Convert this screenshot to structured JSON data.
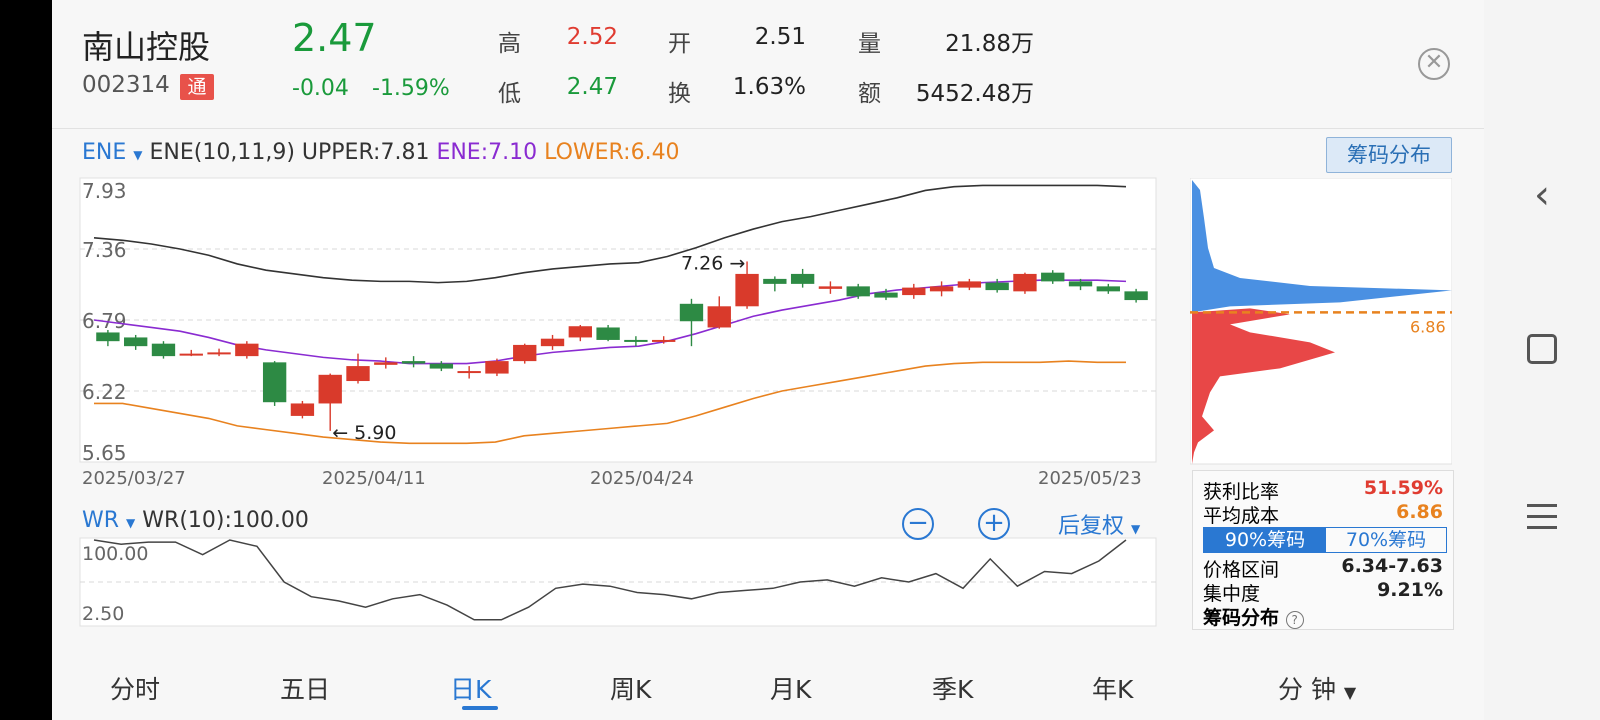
{
  "stock": {
    "name": "南山控股",
    "code": "002314",
    "tong_badge": "通",
    "price": "2.47",
    "change": "-0.04",
    "change_pct": "-1.59%"
  },
  "quote": {
    "high_label": "高",
    "high_value": "2.52",
    "low_label": "低",
    "low_value": "2.47",
    "open_label": "开",
    "open_value": "2.51",
    "turnover_label": "换",
    "turnover_value": "1.63%",
    "volume_label": "量",
    "volume_value": "21.88万",
    "amount_label": "额",
    "amount_value": "5452.48万"
  },
  "close_icon": "close-icon",
  "ene": {
    "indicator": "ENE",
    "params": "ENE(10,11,9)",
    "upper": "UPPER:7.81",
    "ene": "ENE:7.10",
    "lower": "LOWER:6.40",
    "colors": {
      "upper": "#333333",
      "ene": "#8a2bd1",
      "lower": "#e8821f"
    }
  },
  "chip_button": "筹码分布",
  "chart_data": {
    "type": "candlestick",
    "y_ticks": [
      "7.93",
      "7.36",
      "6.79",
      "6.22",
      "5.65"
    ],
    "y_tick_values": [
      7.93,
      7.36,
      6.79,
      6.22,
      5.65
    ],
    "ylim": [
      5.65,
      7.93
    ],
    "x_labels": [
      "2025/03/27",
      "2025/04/11",
      "2025/04/24",
      "2025/05/23"
    ],
    "annotations": {
      "high": "7.26",
      "low": "5.90"
    },
    "candles": [
      {
        "o": 6.69,
        "c": 6.62,
        "h": 6.71,
        "l": 6.58
      },
      {
        "o": 6.65,
        "c": 6.58,
        "h": 6.67,
        "l": 6.55
      },
      {
        "o": 6.6,
        "c": 6.5,
        "h": 6.62,
        "l": 6.48
      },
      {
        "o": 6.51,
        "c": 6.52,
        "h": 6.55,
        "l": 6.5
      },
      {
        "o": 6.52,
        "c": 6.53,
        "h": 6.56,
        "l": 6.5
      },
      {
        "o": 6.5,
        "c": 6.6,
        "h": 6.62,
        "l": 6.48
      },
      {
        "o": 6.45,
        "c": 6.13,
        "h": 6.46,
        "l": 6.1
      },
      {
        "o": 6.02,
        "c": 6.12,
        "h": 6.14,
        "l": 6.0
      },
      {
        "o": 6.12,
        "c": 6.35,
        "h": 6.36,
        "l": 5.9
      },
      {
        "o": 6.3,
        "c": 6.42,
        "h": 6.52,
        "l": 6.28
      },
      {
        "o": 6.43,
        "c": 6.45,
        "h": 6.49,
        "l": 6.4
      },
      {
        "o": 6.46,
        "c": 6.44,
        "h": 6.5,
        "l": 6.41
      },
      {
        "o": 6.44,
        "c": 6.4,
        "h": 6.46,
        "l": 6.38
      },
      {
        "o": 6.38,
        "c": 6.38,
        "h": 6.42,
        "l": 6.32
      },
      {
        "o": 6.36,
        "c": 6.46,
        "h": 6.48,
        "l": 6.34
      },
      {
        "o": 6.46,
        "c": 6.59,
        "h": 6.6,
        "l": 6.44
      },
      {
        "o": 6.58,
        "c": 6.64,
        "h": 6.67,
        "l": 6.55
      },
      {
        "o": 6.65,
        "c": 6.74,
        "h": 6.75,
        "l": 6.62
      },
      {
        "o": 6.73,
        "c": 6.63,
        "h": 6.75,
        "l": 6.62
      },
      {
        "o": 6.63,
        "c": 6.62,
        "h": 6.66,
        "l": 6.58
      },
      {
        "o": 6.62,
        "c": 6.63,
        "h": 6.66,
        "l": 6.6
      },
      {
        "o": 6.92,
        "c": 6.78,
        "h": 6.96,
        "l": 6.58
      },
      {
        "o": 6.73,
        "c": 6.9,
        "h": 6.98,
        "l": 6.72
      },
      {
        "o": 6.9,
        "c": 7.16,
        "h": 7.26,
        "l": 6.88
      },
      {
        "o": 7.12,
        "c": 7.08,
        "h": 7.14,
        "l": 7.02
      },
      {
        "o": 7.16,
        "c": 7.08,
        "h": 7.2,
        "l": 7.05
      },
      {
        "o": 7.04,
        "c": 7.06,
        "h": 7.1,
        "l": 7.0
      },
      {
        "o": 7.06,
        "c": 6.98,
        "h": 7.08,
        "l": 6.96
      },
      {
        "o": 7.01,
        "c": 6.97,
        "h": 7.04,
        "l": 6.95
      },
      {
        "o": 6.99,
        "c": 7.05,
        "h": 7.08,
        "l": 6.96
      },
      {
        "o": 7.02,
        "c": 7.06,
        "h": 7.1,
        "l": 6.98
      },
      {
        "o": 7.05,
        "c": 7.1,
        "h": 7.12,
        "l": 7.03
      },
      {
        "o": 7.09,
        "c": 7.03,
        "h": 7.12,
        "l": 7.01
      },
      {
        "o": 7.02,
        "c": 7.16,
        "h": 7.17,
        "l": 7.0
      },
      {
        "o": 7.17,
        "c": 7.1,
        "h": 7.19,
        "l": 7.08
      },
      {
        "o": 7.1,
        "c": 7.06,
        "h": 7.12,
        "l": 7.03
      },
      {
        "o": 7.06,
        "c": 7.02,
        "h": 7.08,
        "l": 7.0
      },
      {
        "o": 7.02,
        "c": 6.95,
        "h": 7.04,
        "l": 6.93
      }
    ],
    "upper": [
      7.45,
      7.43,
      7.4,
      7.36,
      7.31,
      7.24,
      7.19,
      7.16,
      7.13,
      7.11,
      7.1,
      7.1,
      7.09,
      7.1,
      7.13,
      7.17,
      7.2,
      7.22,
      7.24,
      7.25,
      7.3,
      7.37,
      7.45,
      7.52,
      7.58,
      7.62,
      7.67,
      7.72,
      7.77,
      7.83,
      7.86,
      7.87,
      7.87,
      7.87,
      7.87,
      7.87,
      7.86
    ],
    "ene_line": [
      6.79,
      6.76,
      6.73,
      6.7,
      6.65,
      6.59,
      6.55,
      6.52,
      6.49,
      6.47,
      6.46,
      6.44,
      6.44,
      6.44,
      6.46,
      6.5,
      6.53,
      6.55,
      6.57,
      6.58,
      6.62,
      6.68,
      6.75,
      6.82,
      6.87,
      6.91,
      6.95,
      7.0,
      7.03,
      7.05,
      7.07,
      7.09,
      7.1,
      7.11,
      7.11,
      7.11,
      7.1
    ],
    "lower": [
      6.12,
      6.12,
      6.08,
      6.04,
      6.0,
      5.94,
      5.91,
      5.88,
      5.85,
      5.83,
      5.81,
      5.8,
      5.8,
      5.8,
      5.81,
      5.86,
      5.88,
      5.9,
      5.92,
      5.94,
      5.96,
      6.02,
      6.09,
      6.16,
      6.22,
      6.26,
      6.3,
      6.34,
      6.38,
      6.42,
      6.44,
      6.45,
      6.45,
      6.45,
      6.46,
      6.45,
      6.45
    ]
  },
  "chip_dist": {
    "avg_cost_label": "6.86",
    "avg_cost_value": 6.86,
    "colors": {
      "profit": "#4a90e2",
      "loss": "#e84747",
      "avg": "#e8821f"
    },
    "profit_ratio_label": "获利比率",
    "profit_ratio_value": "51.59%",
    "avg_cost_row_label": "平均成本",
    "avg_cost_row_value": "6.86",
    "tab_90": "90%筹码",
    "tab_70": "70%筹码",
    "range_label": "价格区间",
    "range_value": "6.34-7.63",
    "concentration_label": "集中度",
    "concentration_value": "9.21%",
    "footer_label": "筹码分布",
    "help_icon": "help-circle-icon"
  },
  "wr": {
    "indicator": "WR",
    "value_text": "WR(10):100.00",
    "y_ticks": [
      "100.00",
      "2.50"
    ],
    "series": [
      100,
      98,
      99,
      99,
      93,
      100,
      97,
      80,
      73,
      71,
      68,
      72,
      74,
      69,
      62,
      62,
      68,
      77,
      79,
      78,
      75,
      74,
      72,
      75,
      76,
      77,
      80,
      81,
      78,
      82,
      80,
      84,
      77,
      91,
      78,
      85,
      84,
      90,
      100
    ],
    "zoom_out_icon": "zoom-out-icon",
    "zoom_in_icon": "zoom-in-icon",
    "restore_label": "后复权"
  },
  "tabs": [
    {
      "label": "分时"
    },
    {
      "label": "五日"
    },
    {
      "label": "日K"
    },
    {
      "label": "周K"
    },
    {
      "label": "月K"
    },
    {
      "label": "季K"
    },
    {
      "label": "年K"
    },
    {
      "label": "分 钟"
    }
  ],
  "active_tab_index": 2,
  "system_nav": {
    "back_icon": "back-icon",
    "home_icon": "home-icon",
    "menu_icon": "menu-icon"
  }
}
